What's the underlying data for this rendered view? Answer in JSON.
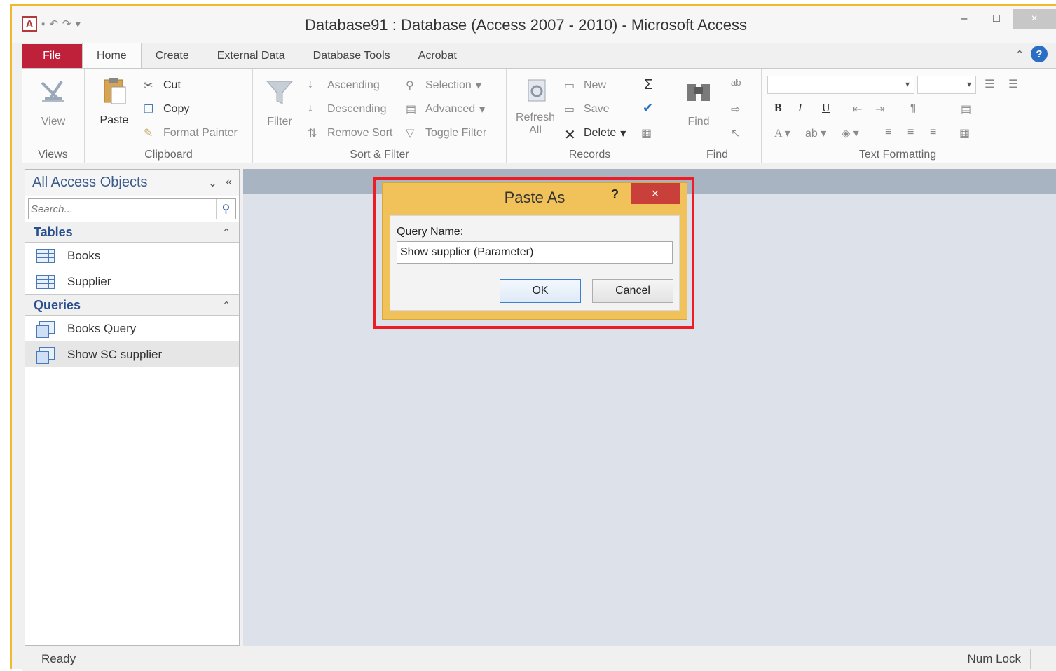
{
  "window": {
    "title": "Database91 : Database (Access 2007 - 2010)  -  Microsoft Access",
    "app_icon": "A",
    "minimize": "–",
    "maximize": "□",
    "close": "×"
  },
  "tabs": [
    {
      "label": "File"
    },
    {
      "label": "Home"
    },
    {
      "label": "Create"
    },
    {
      "label": "External Data"
    },
    {
      "label": "Database Tools"
    },
    {
      "label": "Acrobat"
    }
  ],
  "ribbon": {
    "views": {
      "group": "Views",
      "view": "View"
    },
    "clipboard": {
      "group": "Clipboard",
      "paste": "Paste",
      "cut": "Cut",
      "copy": "Copy",
      "format_painter": "Format Painter"
    },
    "sort_filter": {
      "group": "Sort & Filter",
      "filter": "Filter",
      "ascending": "Ascending",
      "descending": "Descending",
      "remove_sort": "Remove Sort",
      "selection": "Selection",
      "advanced": "Advanced",
      "toggle_filter": "Toggle Filter"
    },
    "records": {
      "group": "Records",
      "refresh": "Refresh",
      "refresh_sub": "All",
      "new": "New",
      "save": "Save",
      "delete": "Delete"
    },
    "find": {
      "group": "Find",
      "find": "Find"
    },
    "text_formatting": {
      "group": "Text Formatting",
      "bold": "B",
      "italic": "I",
      "underline": "U"
    }
  },
  "nav": {
    "title": "All Access Objects",
    "search_placeholder": "Search...",
    "sections": [
      {
        "label": "Tables",
        "items": [
          "Books",
          "Supplier"
        ]
      },
      {
        "label": "Queries",
        "items": [
          "Books Query",
          "Show SC supplier"
        ]
      }
    ]
  },
  "dialog": {
    "title": "Paste As",
    "help": "?",
    "close": "×",
    "label": "Query Name:",
    "value": "Show supplier (Parameter)",
    "ok": "OK",
    "cancel": "Cancel"
  },
  "status": {
    "left": "Ready",
    "right": "Num Lock"
  }
}
